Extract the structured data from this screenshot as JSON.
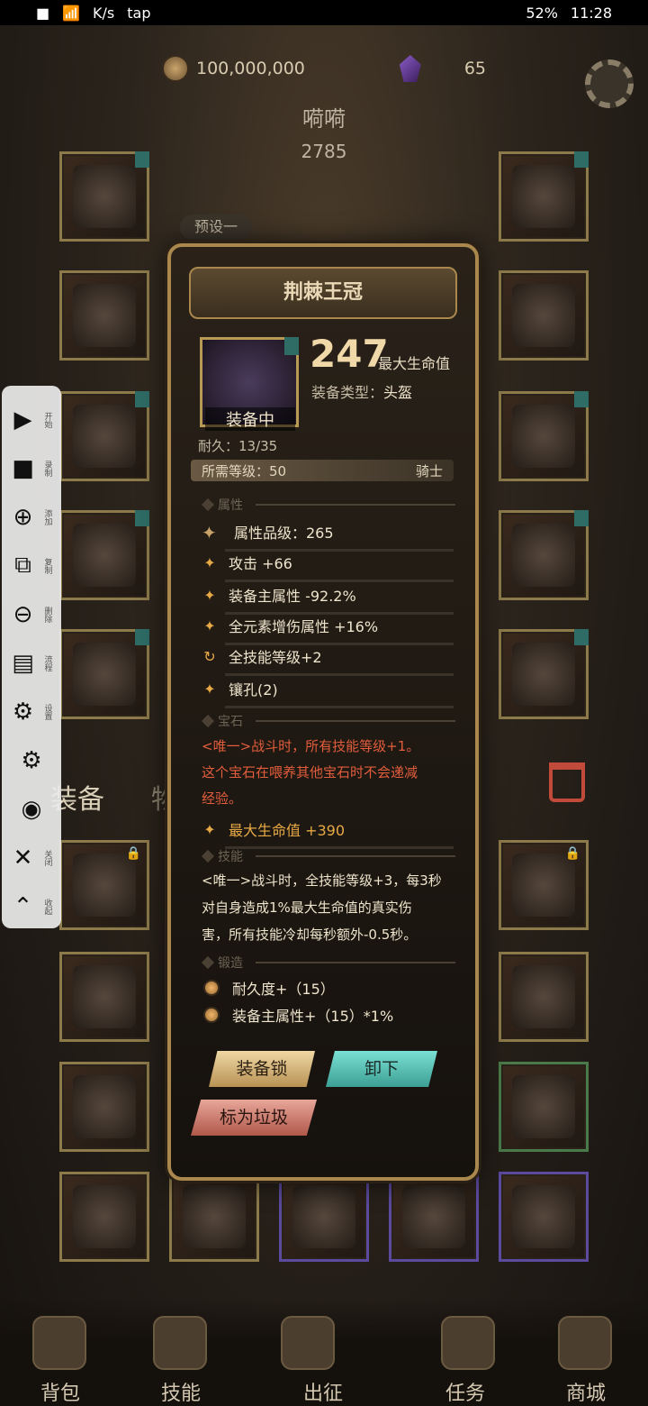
{
  "status_bar": {
    "speed": "K/s",
    "battery": "52%",
    "time": "11:28",
    "app_tag": "tap"
  },
  "currency": {
    "gold": "100,000,000",
    "gems": "65"
  },
  "character": {
    "name": "嗬嗬",
    "power": "2785",
    "preset": "预设一"
  },
  "recorder": {
    "items": [
      {
        "label": "开始",
        "icon": "play-icon"
      },
      {
        "label": "录制",
        "icon": "camera-icon"
      },
      {
        "label": "添加",
        "icon": "plus-circle-icon"
      },
      {
        "label": "复制",
        "icon": "copy-icon"
      },
      {
        "label": "删除",
        "icon": "minus-circle-icon"
      },
      {
        "label": "流程",
        "icon": "flow-icon"
      },
      {
        "label": "设置",
        "icon": "gear-icon"
      },
      {
        "label": "",
        "icon": "gear-settings-icon"
      },
      {
        "label": "",
        "icon": "eye-icon"
      },
      {
        "label": "关闭",
        "icon": "close-icon"
      },
      {
        "label": "收起",
        "icon": "collapse-icon"
      }
    ]
  },
  "tabs": {
    "equipment": "装备",
    "items": "物"
  },
  "popup": {
    "title": "荆棘王冠",
    "equipped_label": "装备中",
    "main_value": "247",
    "main_value_label": "最大生命值",
    "slot_type_label": "装备类型：",
    "slot_type": "头盔",
    "durability": "耐久：13/35",
    "req_level": "所需等级：50",
    "req_class": "骑士",
    "sections": {
      "attributes": "属性",
      "gem": "宝石",
      "skill": "技能",
      "forge": "锻造"
    },
    "attributes": [
      "属性品级：265",
      "攻击 +66",
      "装备主属性 -92.2%",
      "全元素增伤属性 +16%",
      "全技能等级+2",
      "镶孔(2)"
    ],
    "gem_lines": [
      "<唯一>战斗时，所有技能等级+1。",
      "这个宝石在喂养其他宝石时不会递减",
      "经验。"
    ],
    "gem_stat": "最大生命值 +390",
    "skill_lines": [
      "<唯一>战斗时，全技能等级+3，每3秒",
      "对自身造成1%最大生命值的真实伤",
      "害，所有技能冷却每秒额外-0.5秒。"
    ],
    "forge": [
      "耐久度+（15）",
      "装备主属性+（15）*1%"
    ],
    "buttons": {
      "lock": "装备锁",
      "unequip": "卸下",
      "trash": "标为垃圾"
    }
  },
  "bottom_nav": [
    "背包",
    "技能",
    "出征",
    "任务",
    "商城"
  ]
}
